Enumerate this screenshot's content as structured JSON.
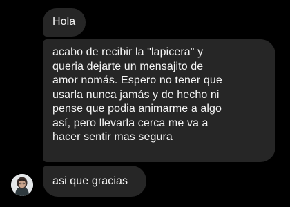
{
  "conversation": {
    "messages": [
      {
        "text": "Hola"
      },
      {
        "text": "acabo de recibir la \"lapicera\" y\nqueria dejarte un mensajito de\namor nomás. Espero no tener que\nusarla nunca jamás y de hecho ni\npense que podia animarme a algo\nasí, pero llevarla cerca me va a\nhacer sentir mas segura"
      },
      {
        "text": "asi que gracias"
      }
    ],
    "sender": {
      "avatar_icon": "user-avatar-icon"
    }
  },
  "colors": {
    "background": "#000000",
    "bubble": "#262626",
    "text": "#f5f5f5"
  }
}
